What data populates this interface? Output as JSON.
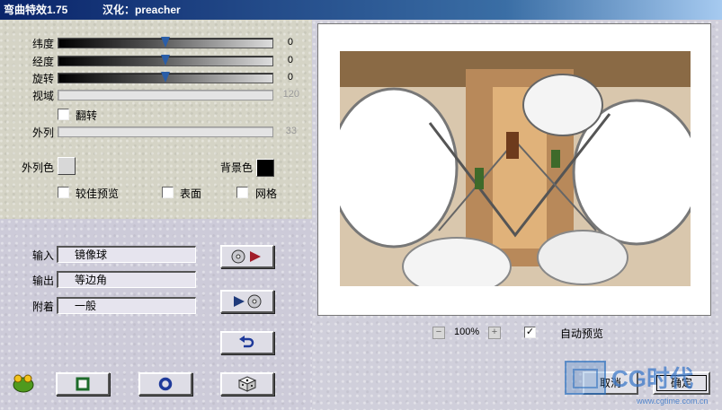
{
  "window": {
    "title": "弯曲特效1.75",
    "credit": "汉化：preacher"
  },
  "sliders": [
    {
      "label": "纬度",
      "value": "0",
      "level": 0.5,
      "enabled": true
    },
    {
      "label": "经度",
      "value": "0",
      "level": 0.5,
      "enabled": true
    },
    {
      "label": "旋转",
      "value": "0",
      "level": 0.5,
      "enabled": true
    },
    {
      "label": "视域",
      "value": "120",
      "enabled": false
    }
  ],
  "flip_label": "翻转",
  "outer_column": {
    "label": "外列",
    "value": "33",
    "enabled": false
  },
  "colors": {
    "outer_color_label": "外列色",
    "outer_color": "#d8d8d8",
    "background_color_label": "背景色",
    "background_color": "#000000",
    "accent": "#2a5ea8"
  },
  "options": {
    "better_preview": "较佳预览",
    "surface": "表面",
    "grid": "网格"
  },
  "mapping": {
    "input_label": "输入",
    "input_value": "镜像球",
    "output_label": "输出",
    "output_value": "等边角",
    "attach_label": "附着",
    "attach_value": "一般"
  },
  "icons": {
    "apply": "cd-play-icon",
    "reverse": "play-cd-icon",
    "undo": "undo-arrow-icon",
    "square": "square-icon",
    "ring": "ring-icon",
    "random": "dice-icon",
    "logo": "frog-logo-icon"
  },
  "preview": {
    "zoom": "100%",
    "auto_preview_label": "自动预览",
    "auto_preview": true
  },
  "buttons": {
    "cancel": "取消",
    "ok": "确定"
  },
  "watermark": {
    "brand": "CG时代",
    "url": "www.cgtime.com.cn"
  }
}
